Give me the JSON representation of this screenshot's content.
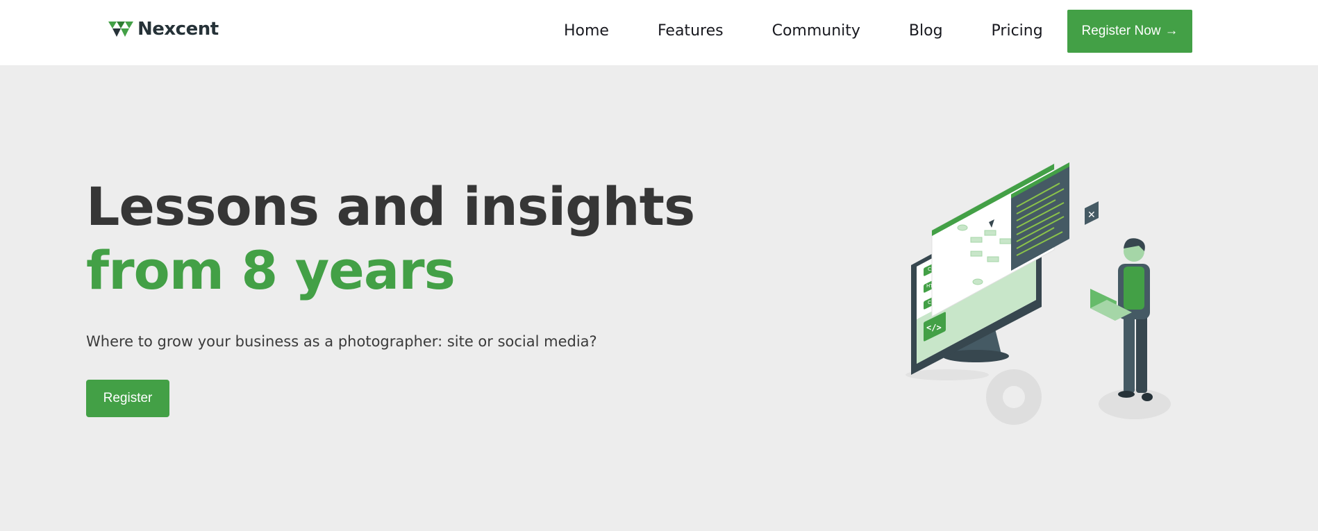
{
  "brand": {
    "name": "Nexcent",
    "logo_icon": "nexcent-logo-icon"
  },
  "nav": {
    "links": [
      "Home",
      "Features",
      "Community",
      "Blog",
      "Pricing"
    ],
    "cta_label": "Register Now",
    "cta_icon": "arrow-right-icon",
    "cta_arrow": "→"
  },
  "hero": {
    "title_line1": "Lessons and insights",
    "title_line2": "from 8 years",
    "subtitle": "Where to grow your business as a photographer: site or social media?",
    "button_label": "Register",
    "illustration": {
      "code_labels": [
        "CSS",
        "HTML",
        "C++"
      ],
      "code_icon": "</>",
      "close_glyph": "✕"
    }
  },
  "colors": {
    "accent": "#43a046",
    "background": "#ededed",
    "navbar": "#ffffff",
    "heading_dark": "#363636",
    "logo_dark": "#263238"
  }
}
